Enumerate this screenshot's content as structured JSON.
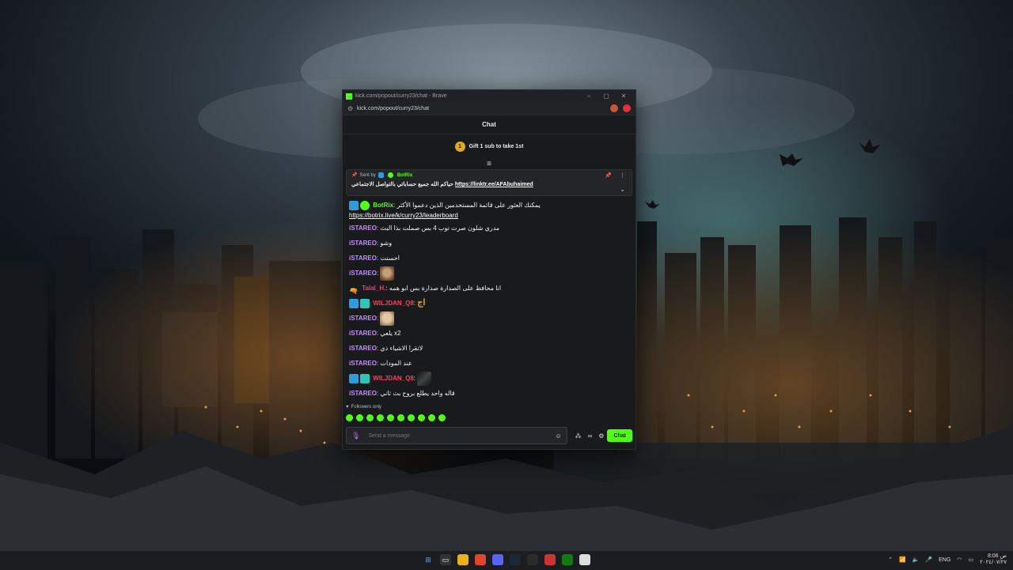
{
  "browser": {
    "tab_title": "kick.com/popout/curry23/chat - Brave",
    "url": "kick.com/popout/curry23/chat"
  },
  "chat": {
    "header": "Chat",
    "gift_rank": "1",
    "gift_label": "Gift 1 sub to take 1st",
    "pinned": {
      "sent_by_label": "Sent by",
      "sender": "BotRix",
      "text": "حياكم الله جميع حساباتي بالتواصل الاجتماعي",
      "link": "https://linktr.ee/AFAbuhaimed"
    },
    "messages": [
      {
        "user": "BotRix",
        "text": "يمكنك العثور على قائمة المستخدمين الذين دعموا الأكثر",
        "link": "https://botrix.live/k/curry23/leaderboard"
      },
      {
        "user": "iSTAREO",
        "text": "مدري شلون صرت توب 4 بس صملت بذا البث"
      },
      {
        "user": "iSTAREO",
        "text": "وشو"
      },
      {
        "user": "iSTAREO",
        "text": "احسنت"
      },
      {
        "user": "iSTAREO",
        "text": ""
      },
      {
        "user": "Talal_H.",
        "text": "انا محافظ على الصدارة صدارة بس ابو همه"
      },
      {
        "user": "WILJDAN_Q8",
        "text": "اج"
      },
      {
        "user": "iSTAREO",
        "text": ""
      },
      {
        "user": "iSTAREO",
        "text": "يلعي x2"
      },
      {
        "user": "iSTAREO",
        "text": "لاتقرا الاشياء ذي"
      },
      {
        "user": "iSTAREO",
        "text": "عند المودات"
      },
      {
        "user": "WILJDAN_Q8",
        "text": ""
      },
      {
        "user": "iSTAREO",
        "text": "قاله واحد يطلع بروح بث ثاني"
      }
    ],
    "followers_only": "Followers only",
    "input_placeholder": "Send a message",
    "send_label": "Chat"
  },
  "icons": {
    "mic": "mic-icon",
    "emoji": "smile-icon",
    "settings": "gear-icon",
    "pin": "pin-icon",
    "more": "more-vertical-icon",
    "chevron": "chevron-down-icon"
  },
  "taskbar": {
    "lang": "ENG",
    "time": "8:06 ص",
    "date": "٢٠٢٤/٠٧/٢٧"
  },
  "colors": {
    "kick_green": "#53fc18",
    "username_purple": "#c58cff",
    "username_red": "#ff3b5c"
  }
}
